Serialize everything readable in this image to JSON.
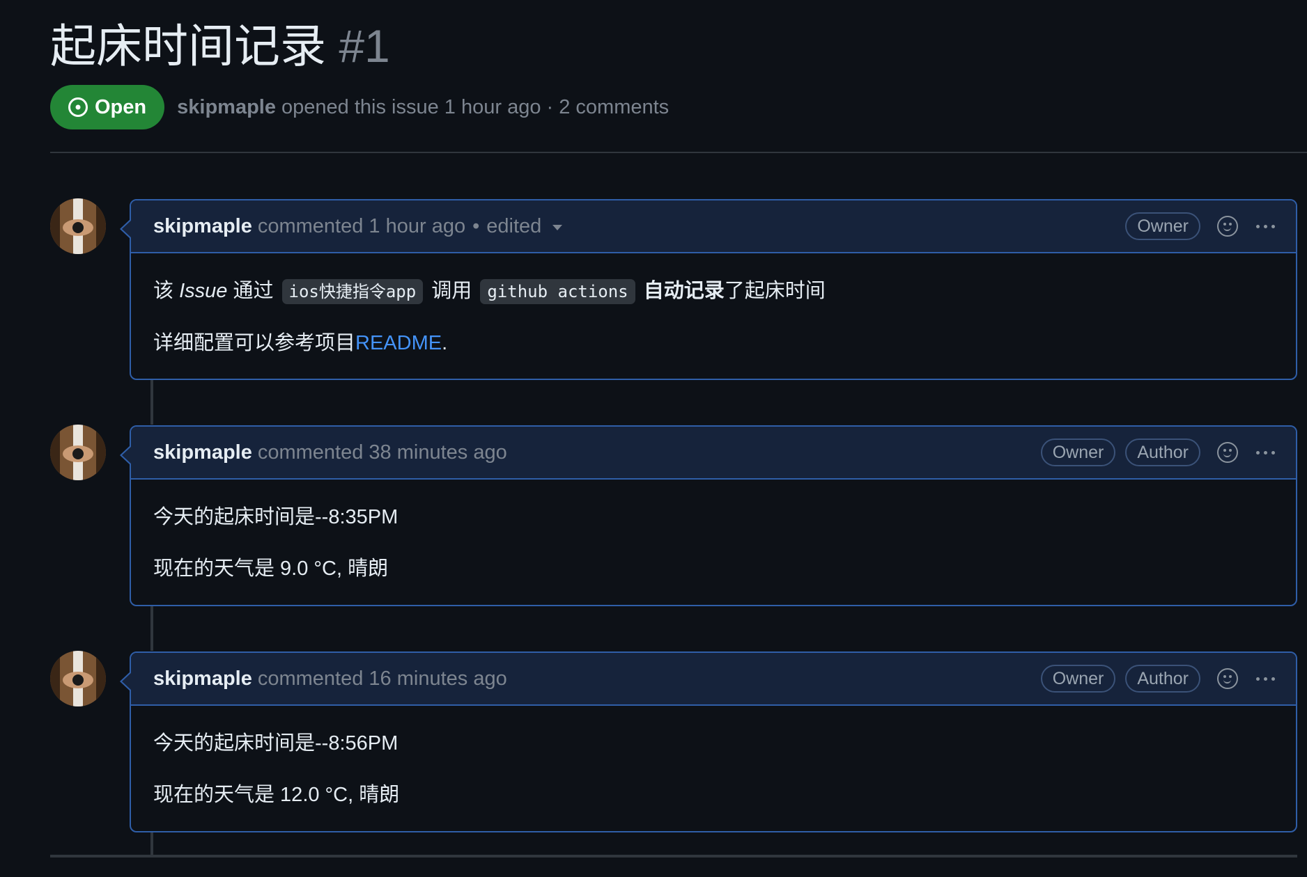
{
  "issue": {
    "title": "起床时间记录",
    "number": "#1",
    "state": "Open",
    "author": "skipmaple",
    "opened_text": "opened this issue 1 hour ago · 2 comments"
  },
  "comments": [
    {
      "author": "skipmaple",
      "meta": "commented 1 hour ago",
      "edited": "edited",
      "badges": [
        "Owner"
      ],
      "body": {
        "t1": "该 ",
        "t2": "Issue",
        "t3": " 通过 ",
        "code1": "ios快捷指令app",
        "t4": " 调用 ",
        "code2": "github actions",
        "t5": " ",
        "bold": "自动记录",
        "t6": "了起床时间",
        "line2_text": "详细配置可以参考项目",
        "link": "README",
        "line2_end": "."
      }
    },
    {
      "author": "skipmaple",
      "meta": "commented 38 minutes ago",
      "badges": [
        "Owner",
        "Author"
      ],
      "lines": [
        "今天的起床时间是--8:35PM",
        "现在的天气是 9.0 °C, 晴朗"
      ]
    },
    {
      "author": "skipmaple",
      "meta": "commented 16 minutes ago",
      "badges": [
        "Owner",
        "Author"
      ],
      "lines": [
        "今天的起床时间是--8:56PM",
        "现在的天气是 12.0 °C, 晴朗"
      ]
    }
  ],
  "icons": {
    "state": "issue-opened-icon",
    "reaction": "smiley-icon",
    "more": "kebab-horizontal-icon",
    "caret": "caret-down-icon"
  },
  "colors": {
    "background": "#0d1117",
    "open_green": "#238636",
    "comment_border": "#2f5ea8",
    "comment_header": "#16233b",
    "link": "#4493f8",
    "muted": "#7d8590"
  }
}
